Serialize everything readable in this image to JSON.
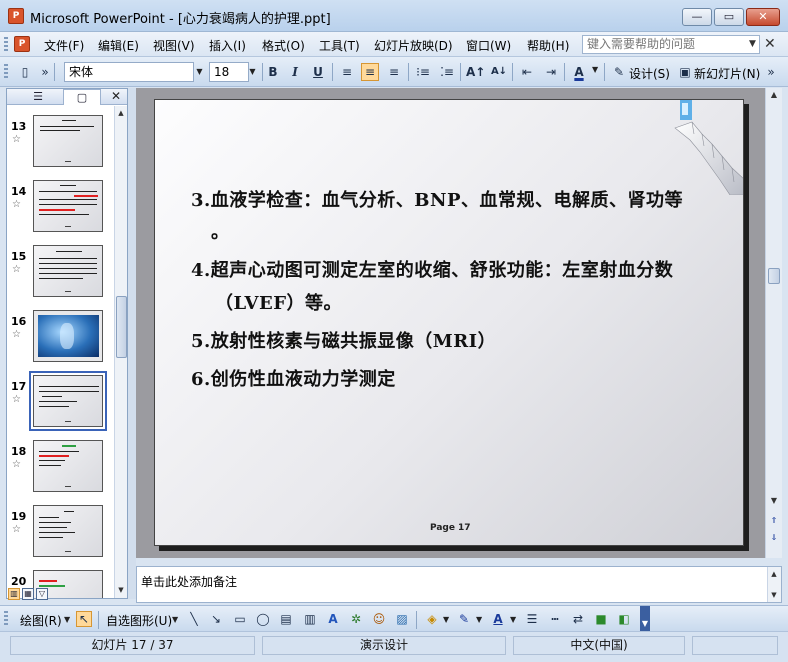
{
  "window": {
    "app_icon": "powerpoint-icon",
    "title": "Microsoft PowerPoint - [心力衰竭病人的护理.ppt]",
    "buttons": {
      "minimize": "—",
      "restore": "▭",
      "close": "✕"
    }
  },
  "menu": {
    "items": [
      "文件(F)",
      "编辑(E)",
      "视图(V)",
      "插入(I)",
      "格式(O)",
      "工具(T)",
      "幻灯片放映(D)",
      "窗口(W)",
      "帮助(H)"
    ],
    "help_placeholder": "键入需要帮助的问题",
    "doc_close": "✕"
  },
  "format_toolbar": {
    "font_name": "宋体",
    "font_size": "18",
    "bold": "B",
    "italic": "I",
    "underline": "U",
    "font_color_letter": "A",
    "design_label": "设计(S)",
    "new_slide_label": "新幻灯片(N)",
    "active_alignment": "center"
  },
  "left_pane": {
    "tabs": {
      "outline": "☰",
      "slides": "▢"
    },
    "close": "✕",
    "thumbnails": [
      {
        "number": "13",
        "star": "☆",
        "selected": false,
        "style": "text"
      },
      {
        "number": "14",
        "star": "☆",
        "selected": false,
        "style": "text-red"
      },
      {
        "number": "15",
        "star": "☆",
        "selected": false,
        "style": "text"
      },
      {
        "number": "16",
        "star": "☆",
        "selected": false,
        "style": "xray"
      },
      {
        "number": "17",
        "star": "☆",
        "selected": true,
        "style": "text"
      },
      {
        "number": "18",
        "star": "☆",
        "selected": false,
        "style": "text-red"
      },
      {
        "number": "19",
        "star": "☆",
        "selected": false,
        "style": "text"
      },
      {
        "number": "20",
        "star": "☆",
        "selected": false,
        "style": "text-green"
      }
    ]
  },
  "slide": {
    "lines": [
      "3.血液学检查：血气分析、BNP、血常规、电解质、肾功等",
      "。",
      "4.超声心动图可测定左室的收缩、舒张功能：左室射血分数",
      "（LVEF）等。",
      "5.放射性核素与磁共振显像（MRI）",
      "6.创伤性血液动力学测定"
    ],
    "page_label": "Page",
    "page_number": "17"
  },
  "notes": {
    "placeholder": "单击此处添加备注"
  },
  "draw_toolbar": {
    "draw_label": "绘图(R)",
    "autoshapes_label": "自选图形(U)"
  },
  "status": {
    "slide_info": "幻灯片 17 / 37",
    "design": "演示设计",
    "language": "中文(中国)"
  },
  "colors": {
    "accent_orange": "#ffd99a",
    "toolbar_blue": "#c9daee",
    "title_red_icon": "#d9542b"
  }
}
